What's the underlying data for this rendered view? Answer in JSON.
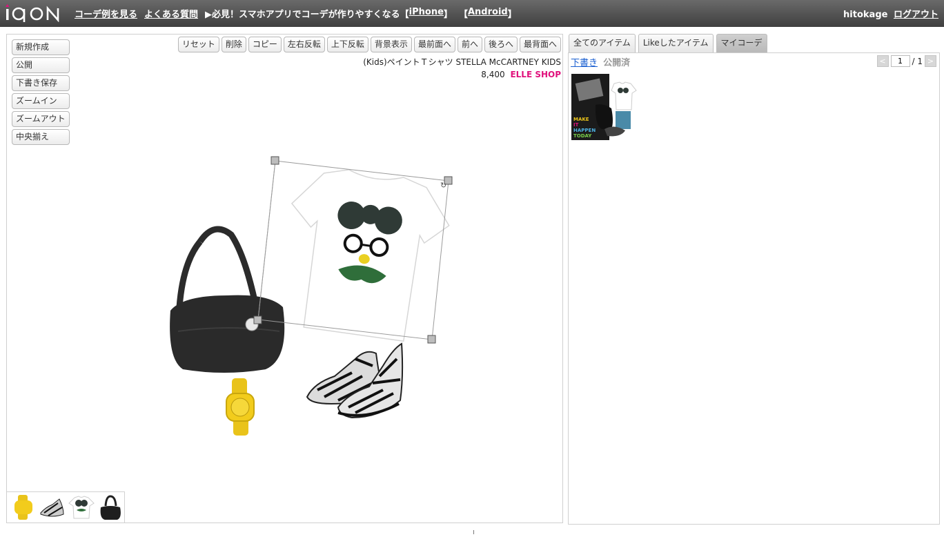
{
  "app": {
    "logo_text": "iQON",
    "nav": {
      "examples": "コーデ例を見る",
      "faq": "よくある質問",
      "promo_text": "▶必見！スマホアプリでコーデが作りやすくなる",
      "iphone": "iPhone",
      "android": "Android"
    },
    "user": {
      "name": "hitokage",
      "logout": "ログアウト"
    }
  },
  "editor": {
    "side_buttons": [
      "新規作成",
      "公開",
      "下書き保存",
      "ズームイン",
      "ズームアウト",
      "中央揃え"
    ],
    "toolbar": [
      "リセット",
      "削除",
      "コピー",
      "左右反転",
      "上下反転",
      "背景表示",
      "最前面へ",
      "前へ",
      "後ろへ",
      "最背面へ"
    ],
    "selected_item": {
      "name": "(Kids)ペイントＴシャツ STELLA McCARTNEY KIDS",
      "price": "8,400",
      "shop": "ELLE SHOP"
    },
    "canvas_items": [
      "tshirt",
      "bag",
      "watch",
      "sneakers"
    ],
    "thumb_strip": [
      "watch",
      "sneakers",
      "tshirt",
      "bag"
    ]
  },
  "right_panel": {
    "tabs": [
      "全てのアイテム",
      "Likeしたアイテム",
      "マイコーデ"
    ],
    "active_tab": "マイコーデ",
    "subtabs": {
      "draft": "下書き",
      "published": "公開済"
    },
    "pager": {
      "prev": "<",
      "current": "1",
      "total": "/ 1",
      "next": ">"
    },
    "coord_text": "MAKE IT HAPPEN TODAY"
  },
  "colors": {
    "accent_pink": "#e0117c",
    "link_blue": "#1a5fd0",
    "topbar": "#4f4f4f"
  }
}
